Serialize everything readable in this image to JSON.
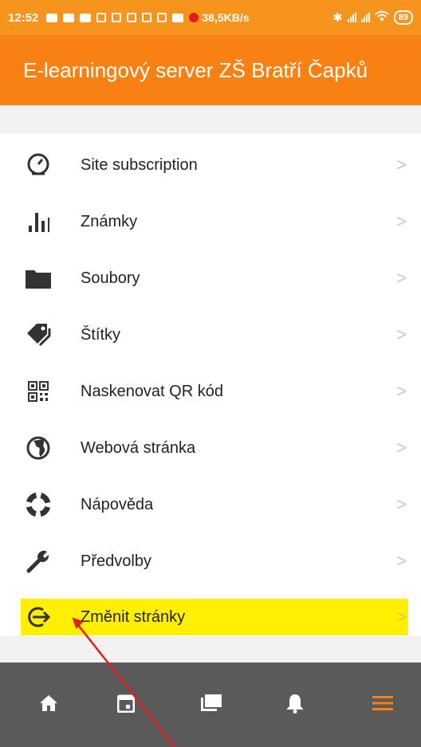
{
  "status_bar": {
    "time": "12:52",
    "speed": "38,5KB/s",
    "battery": "89"
  },
  "header": {
    "title": "E-learningový server ZŠ Bratří Čapků"
  },
  "menu": {
    "items": [
      {
        "label": "Site subscription",
        "icon": "speedometer-icon"
      },
      {
        "label": "Známky",
        "icon": "bar-chart-icon"
      },
      {
        "label": "Soubory",
        "icon": "folder-icon"
      },
      {
        "label": "Štítky",
        "icon": "tags-icon"
      },
      {
        "label": "Naskenovat QR kód",
        "icon": "qr-code-icon"
      },
      {
        "label": "Webová stránka",
        "icon": "globe-icon"
      },
      {
        "label": "Nápověda",
        "icon": "lifebuoy-icon"
      },
      {
        "label": "Předvolby",
        "icon": "wrench-icon"
      },
      {
        "label": "Změnit stránky",
        "icon": "exit-icon"
      }
    ],
    "chevron": ">"
  },
  "tabs": [
    {
      "name": "home-icon"
    },
    {
      "name": "calendar-icon"
    },
    {
      "name": "messages-icon"
    },
    {
      "name": "bell-icon"
    },
    {
      "name": "menu-icon"
    }
  ],
  "colors": {
    "primary": "#f98012",
    "highlight": "#ffef00",
    "tab_bar": "#5a5a5a",
    "active_tab": "#f98012",
    "annotation_arrow": "#e0201c"
  }
}
